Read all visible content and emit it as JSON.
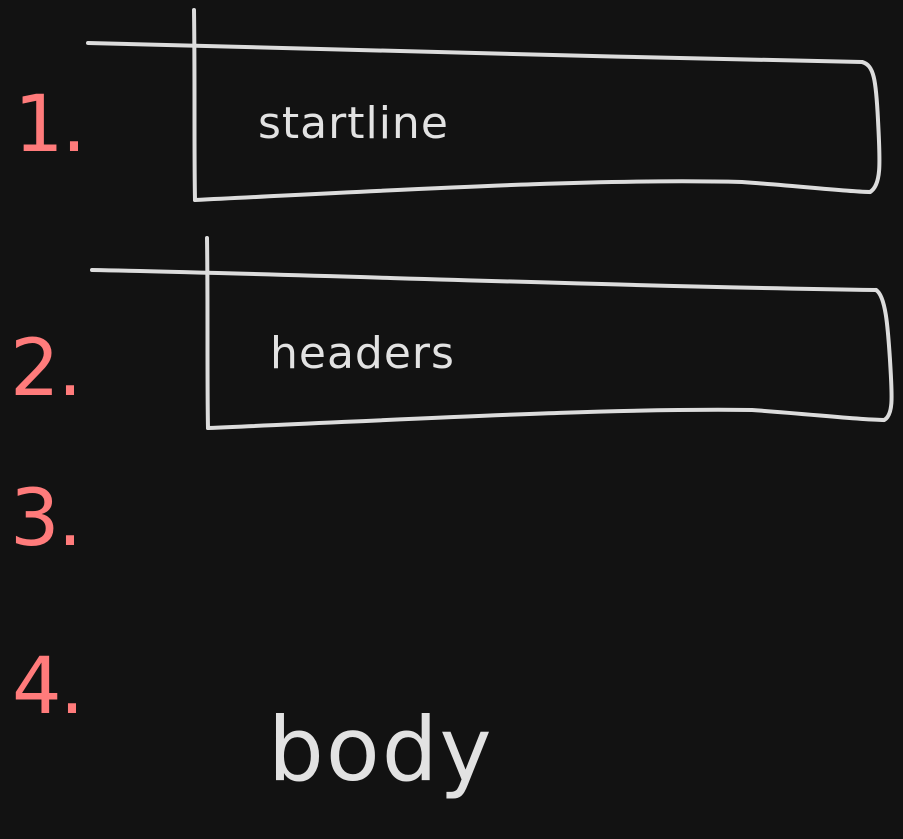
{
  "colors": {
    "background": "#121212",
    "number": "#ff7b7b",
    "stroke": "#dcdcdc",
    "text": "#e2e2e2"
  },
  "items": [
    {
      "number": "1.",
      "label": "startline"
    },
    {
      "number": "2.",
      "label": "headers"
    },
    {
      "number": "3.",
      "label": ""
    },
    {
      "number": "4.",
      "label": "body"
    }
  ]
}
